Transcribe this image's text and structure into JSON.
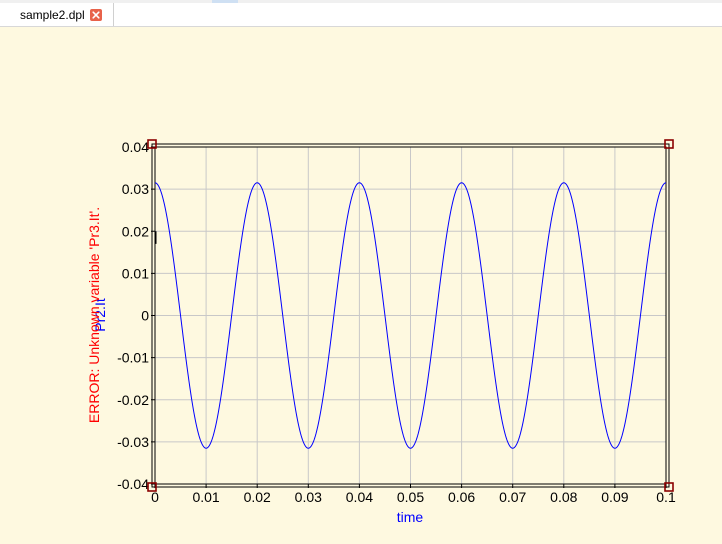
{
  "tab": {
    "label": "sample2.dpl"
  },
  "chart_data": {
    "type": "line",
    "xlabel": "time",
    "ylabel": "Pr2.It",
    "error_label": "ERROR: Unknown variable 'Pr3.It'.",
    "xlim": [
      0,
      0.1
    ],
    "ylim": [
      -0.04,
      0.04
    ],
    "x_ticks": [
      "0",
      "0.01",
      "0.02",
      "0.03",
      "0.04",
      "0.05",
      "0.06",
      "0.07",
      "0.08",
      "0.09",
      "0.1"
    ],
    "y_ticks": [
      "0.04",
      "0.03",
      "0.02",
      "0.01",
      "0",
      "-0.01",
      "-0.02",
      "-0.03",
      "-0.04"
    ],
    "series": [
      {
        "amplitude": 0.0315,
        "frequency_hz": 50,
        "phase": "cosine",
        "color": "#0000ff"
      }
    ],
    "grid": true
  },
  "colors": {
    "error": "#ff0000",
    "series": "#0000ff",
    "background": "#fef9e0",
    "grid": "#c8c8c8",
    "handle": "#8b0000"
  }
}
